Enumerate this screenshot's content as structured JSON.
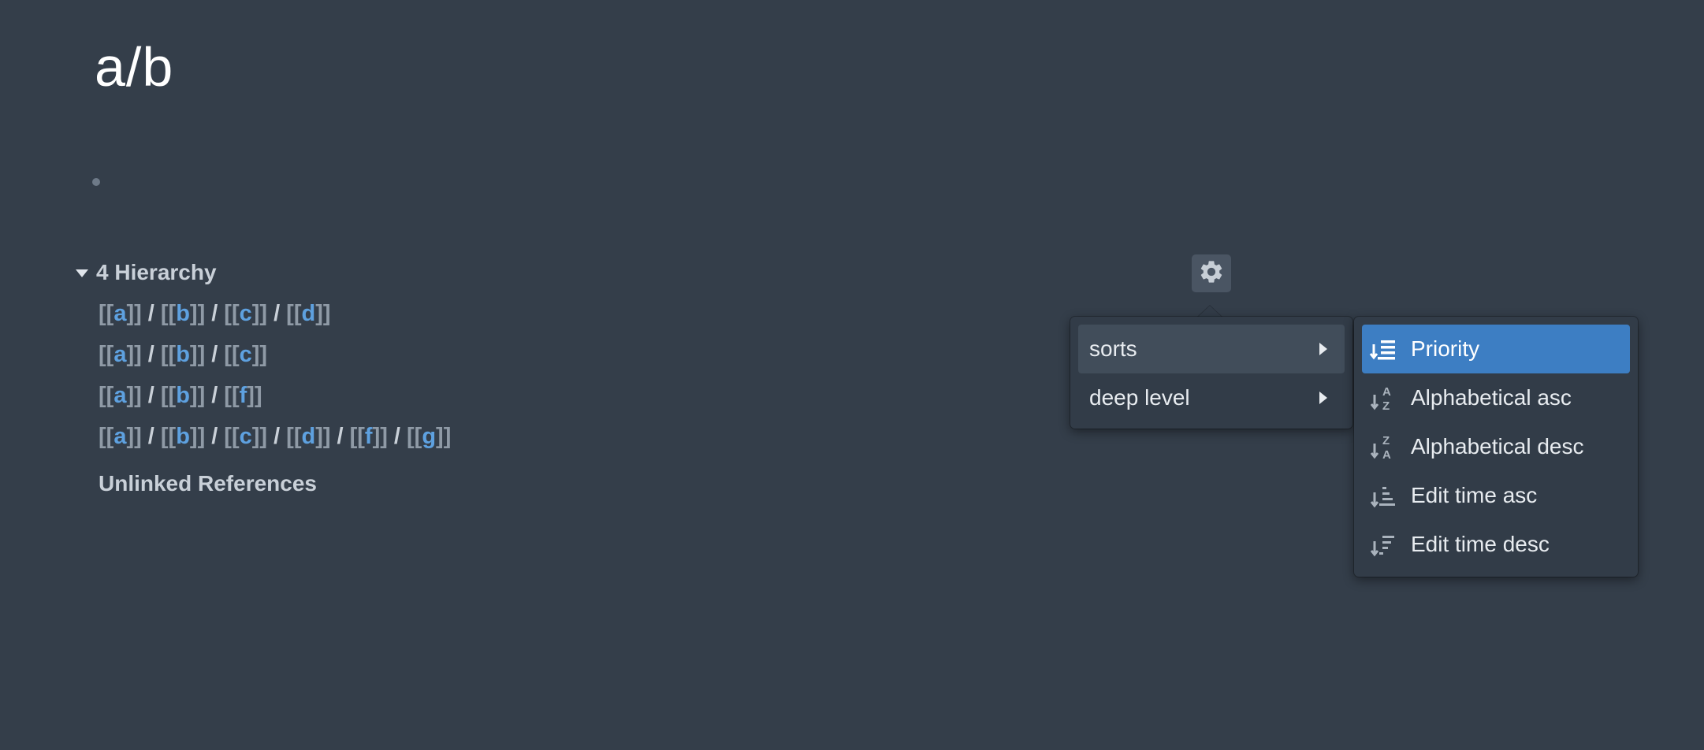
{
  "page": {
    "title": "a/b"
  },
  "hierarchy": {
    "title": "4 Hierarchy",
    "rows": [
      [
        "a",
        "b",
        "c",
        "d"
      ],
      [
        "a",
        "b",
        "c"
      ],
      [
        "a",
        "b",
        "f"
      ],
      [
        "a",
        "b",
        "c",
        "d",
        "f",
        "g"
      ]
    ]
  },
  "unlinked": {
    "label": "Unlinked References"
  },
  "menu": {
    "gear_icon": "gear-icon",
    "items": [
      {
        "label": "sorts",
        "icon": "chevron-right-icon"
      },
      {
        "label": "deep level",
        "icon": "chevron-right-icon"
      }
    ]
  },
  "submenu": {
    "items": [
      {
        "label": "Priority",
        "icon": "sort-priority-icon",
        "selected": true
      },
      {
        "label": "Alphabetical asc",
        "icon": "sort-alpha-asc-icon",
        "selected": false
      },
      {
        "label": "Alphabetical desc",
        "icon": "sort-alpha-desc-icon",
        "selected": false
      },
      {
        "label": "Edit time asc",
        "icon": "sort-time-asc-icon",
        "selected": false
      },
      {
        "label": "Edit time desc",
        "icon": "sort-time-desc-icon",
        "selected": false
      }
    ]
  },
  "colors": {
    "background": "#343e4a",
    "link": "#5ea1e0",
    "selected": "#3d7ec3",
    "menu": "#323c48"
  }
}
